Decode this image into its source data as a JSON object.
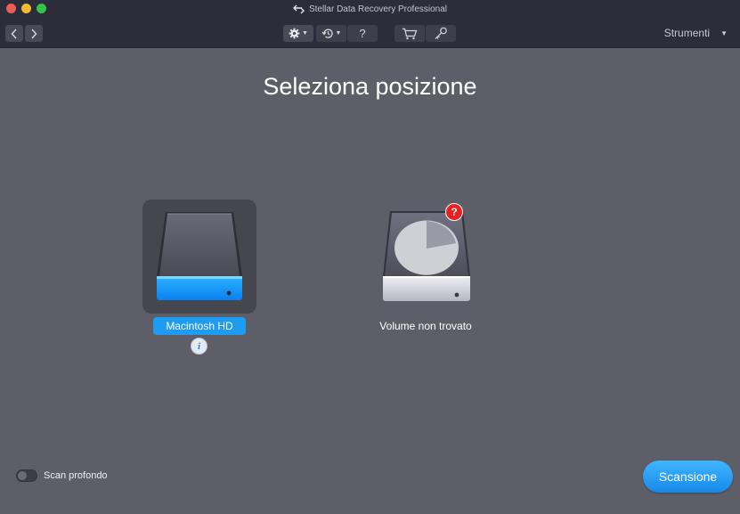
{
  "window": {
    "title": "Stellar Data Recovery Professional"
  },
  "toolbar": {
    "back_icon": "chevron-left-icon",
    "forward_icon": "chevron-right-icon",
    "settings_icon": "gear-icon",
    "history_icon": "history-icon",
    "help_label": "?",
    "cart_icon": "cart-icon",
    "key_icon": "key-icon",
    "tools_label": "Strumenti"
  },
  "main": {
    "title": "Seleziona posizione",
    "drives": [
      {
        "label": "Macintosh HD",
        "selected": true,
        "accent": "#1e9bf2"
      },
      {
        "label": "Volume non trovato",
        "selected": false,
        "badge": "?",
        "badge_color": "#e82020"
      }
    ]
  },
  "footer": {
    "deep_scan_label": "Scan profondo",
    "deep_scan_on": false,
    "scan_button": "Scansione"
  },
  "colors": {
    "background": "#5e5e69",
    "toolbar": "#2c2c3a",
    "accent": "#1e9bf2"
  }
}
